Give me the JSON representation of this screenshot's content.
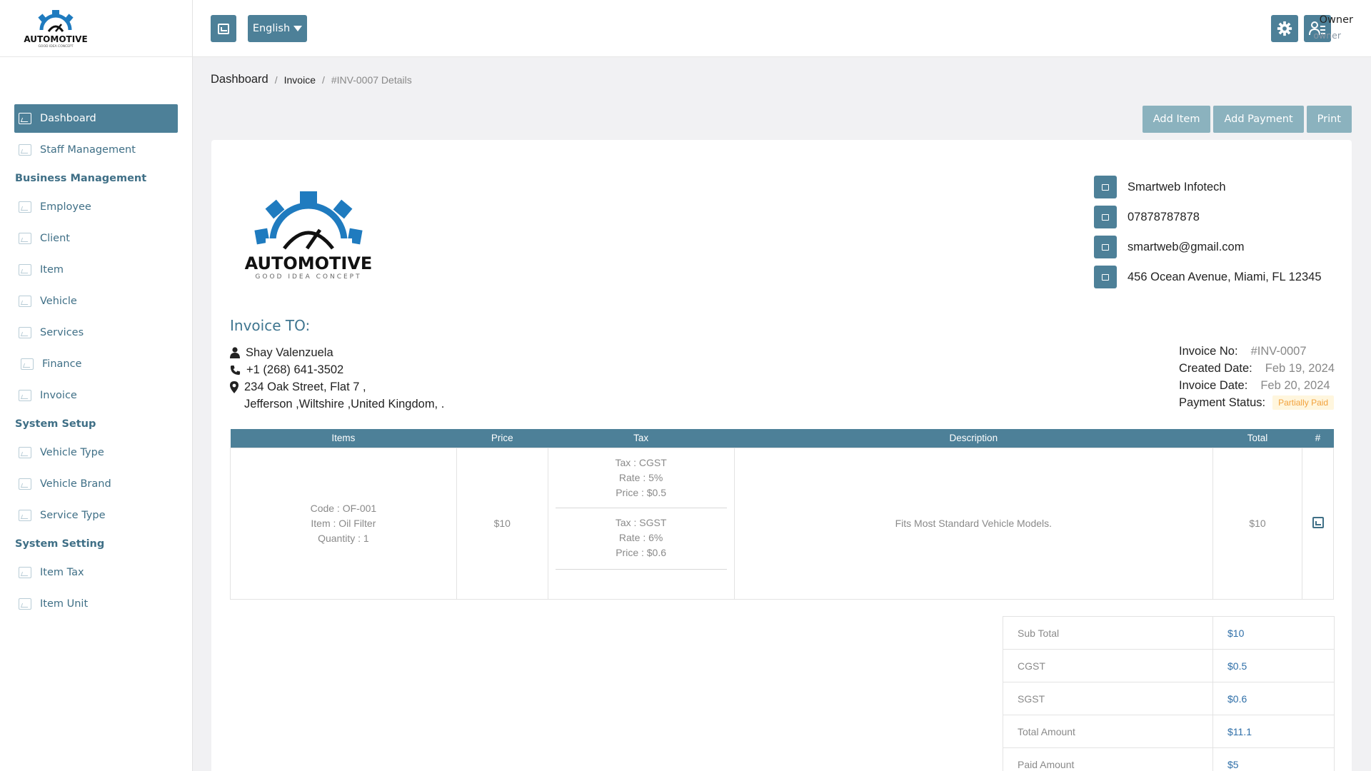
{
  "brand": {
    "name": "AUTOMOTIVE",
    "tagline": "GOOD IDEA CONCEPT"
  },
  "sidebar": {
    "items": [
      {
        "label": "Dashboard",
        "active": true
      },
      {
        "label": "Staff Management"
      }
    ],
    "sections": [
      {
        "title": "Business Management",
        "items": [
          "Employee",
          "Client",
          "Item",
          "Vehicle",
          "Services",
          "Finance",
          "Invoice"
        ]
      },
      {
        "title": "System Setup",
        "items": [
          "Vehicle Type",
          "Vehicle Brand",
          "Service Type"
        ]
      },
      {
        "title": "System Setting",
        "items": [
          "Item Tax",
          "Item Unit"
        ]
      }
    ]
  },
  "header": {
    "language": "English",
    "user_name": "Owner",
    "user_role": "owner"
  },
  "breadcrumb": {
    "home": "Dashboard",
    "section": "Invoice",
    "current": "#INV-0007 Details"
  },
  "actions": {
    "add_item": "Add Item",
    "add_payment": "Add Payment",
    "print": "Print"
  },
  "company": {
    "name": "Smartweb Infotech",
    "phone": "07878787878",
    "email": "smartweb@gmail.com",
    "address": "456 Ocean Avenue, Miami, FL 12345"
  },
  "invoice_to": {
    "heading": "Invoice TO:",
    "name": "Shay Valenzuela",
    "phone": "+1 (268) 641-3502",
    "address_line1": "234 Oak Street, Flat 7 ,",
    "address_line2": "Jefferson ,Wiltshire ,United Kingdom, ."
  },
  "meta": {
    "invoice_no_label": "Invoice No:",
    "invoice_no": "#INV-0007",
    "created_label": "Created Date:",
    "created": "Feb 19, 2024",
    "invoice_date_label": "Invoice Date:",
    "invoice_date": "Feb 20, 2024",
    "status_label": "Payment Status:",
    "status": "Partially Paid",
    "status_color": "#f2a23d"
  },
  "table": {
    "headers": {
      "items": "Items",
      "price": "Price",
      "tax": "Tax",
      "description": "Description",
      "total": "Total",
      "action": "#"
    },
    "row": {
      "code": "Code : OF-001",
      "item": "Item : Oil Filter",
      "quantity": "Quantity : 1",
      "price": "$10",
      "taxes": [
        {
          "name": "Tax : CGST",
          "rate": "Rate : 5%",
          "price": "Price : $0.5"
        },
        {
          "name": "Tax : SGST",
          "rate": "Rate : 6%",
          "price": "Price : $0.6"
        }
      ],
      "description": "Fits Most Standard Vehicle Models.",
      "total": "$10"
    }
  },
  "totals": [
    {
      "label": "Sub Total",
      "value": "$10"
    },
    {
      "label": "CGST",
      "value": "$0.5"
    },
    {
      "label": "SGST",
      "value": "$0.6"
    },
    {
      "label": "Total Amount",
      "value": "$11.1"
    },
    {
      "label": "Paid Amount",
      "value": "$5"
    }
  ],
  "colors": {
    "primary": "#4d8098",
    "action_button": "#8bb2be",
    "link": "#2f6fa8"
  }
}
